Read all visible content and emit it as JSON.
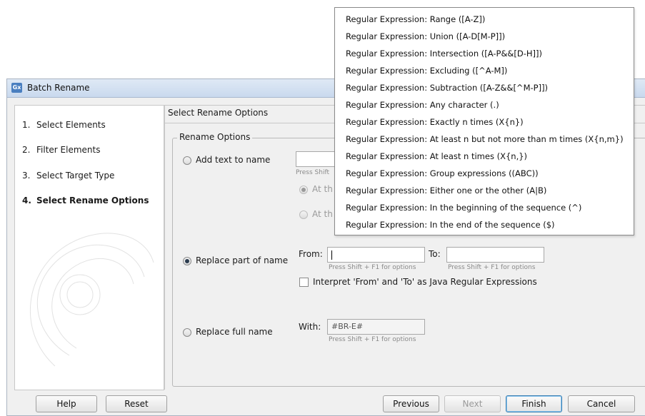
{
  "window": {
    "icon_text": "Gx",
    "title": "Batch Rename"
  },
  "steps": [
    {
      "num": "1.",
      "label": "Select Elements"
    },
    {
      "num": "2.",
      "label": "Filter Elements"
    },
    {
      "num": "3.",
      "label": "Select Target Type"
    },
    {
      "num": "4.",
      "label": "Select Rename Options"
    }
  ],
  "content": {
    "section_title": "Select Rename Options",
    "group_title": "Rename Options",
    "add_text": {
      "label": "Add text to name",
      "hint": "Press Shift",
      "option1": "At th",
      "option2": "At th"
    },
    "replace_part": {
      "label": "Replace part of name",
      "from_label": "From:",
      "to_label": "To:",
      "from_hint": "Press Shift + F1 for options",
      "to_hint": "Press Shift + F1 for options",
      "regex_checkbox": "Interpret 'From' and 'To' as Java Regular Expressions"
    },
    "replace_full": {
      "label": "Replace full name",
      "with_label": "With:",
      "with_value": "#BR-E#",
      "with_hint": "Press Shift + F1 for options"
    }
  },
  "buttons": {
    "help": "Help",
    "reset": "Reset",
    "previous": "Previous",
    "next": "Next",
    "finish": "Finish",
    "cancel": "Cancel"
  },
  "popup_items": [
    "Regular Expression: Range ([A-Z])",
    "Regular Expression: Union ([A-D[M-P]])",
    "Regular Expression: Intersection ([A-P&&[D-H]])",
    "Regular Expression: Excluding ([^A-M])",
    "Regular Expression: Subtraction ([A-Z&&[^M-P]])",
    "Regular Expression: Any character (.)",
    "Regular Expression: Exactly n times (X{n})",
    "Regular Expression: At least n but not more than m times (X{n,m})",
    "Regular Expression: At least n times (X{n,})",
    "Regular Expression: Group expressions ((ABC))",
    "Regular Expression: Either one or the other (A|B)",
    "Regular Expression: In the beginning of the sequence (^)",
    "Regular Expression: In the end of the sequence ($)"
  ],
  "colors": {
    "titlebar": "#c9d9ee",
    "default_button_border": "#3c7fb1",
    "panel_bg": "#f0f0f0"
  }
}
